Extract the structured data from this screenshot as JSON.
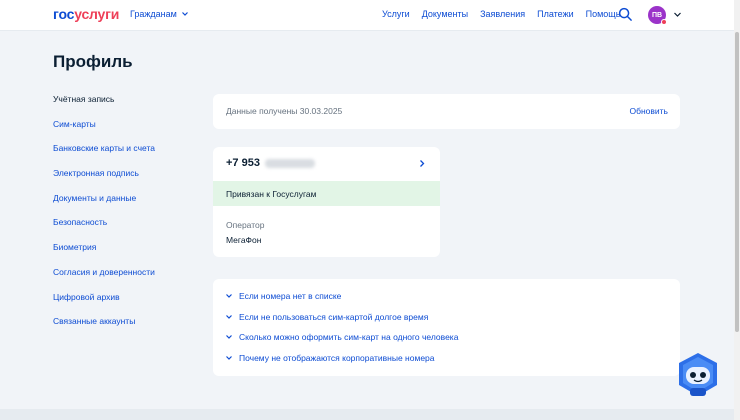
{
  "header": {
    "logo_part1": "гос",
    "logo_part2": "услуги",
    "audience": "Гражданам",
    "nav": [
      "Услуги",
      "Документы",
      "Заявления",
      "Платежи",
      "Помощь"
    ],
    "avatar_initials": "ПВ",
    "accent_color": "#0d4cd3",
    "brand_red": "#ee3f58",
    "avatar_color": "#9b33c9"
  },
  "page_title": "Профиль",
  "sidebar": {
    "items": [
      {
        "label": "Учётная запись",
        "active": true
      },
      {
        "label": "Сим-карты",
        "active": false
      },
      {
        "label": "Банковские карты и счета",
        "active": false
      },
      {
        "label": "Электронная подпись",
        "active": false
      },
      {
        "label": "Документы и данные",
        "active": false
      },
      {
        "label": "Безопасность",
        "active": false
      },
      {
        "label": "Биометрия",
        "active": false
      },
      {
        "label": "Согласия и доверенности",
        "active": false
      },
      {
        "label": "Цифровой архив",
        "active": false
      },
      {
        "label": "Связанные аккаунты",
        "active": false
      }
    ]
  },
  "data_card": {
    "text": "Данные получены 30.03.2025",
    "refresh_label": "Обновить"
  },
  "sim_card": {
    "number_prefix": "+7 953",
    "linked_text": "Привязан к Госуслугам",
    "operator_label": "Оператор",
    "operator_value": "МегаФон",
    "linked_bg": "#e2f5e6"
  },
  "faq": {
    "items": [
      "Если номера нет в списке",
      "Если не пользоваться сим-картой долгое время",
      "Сколько можно оформить сим-карт на одного человека",
      "Почему не отображаются корпоративные номера"
    ]
  },
  "icons": {
    "search": "search-icon",
    "chevron_down": "chevron-down-icon",
    "chevron_right": "chevron-right-icon",
    "assistant": "assistant-robot-icon"
  }
}
